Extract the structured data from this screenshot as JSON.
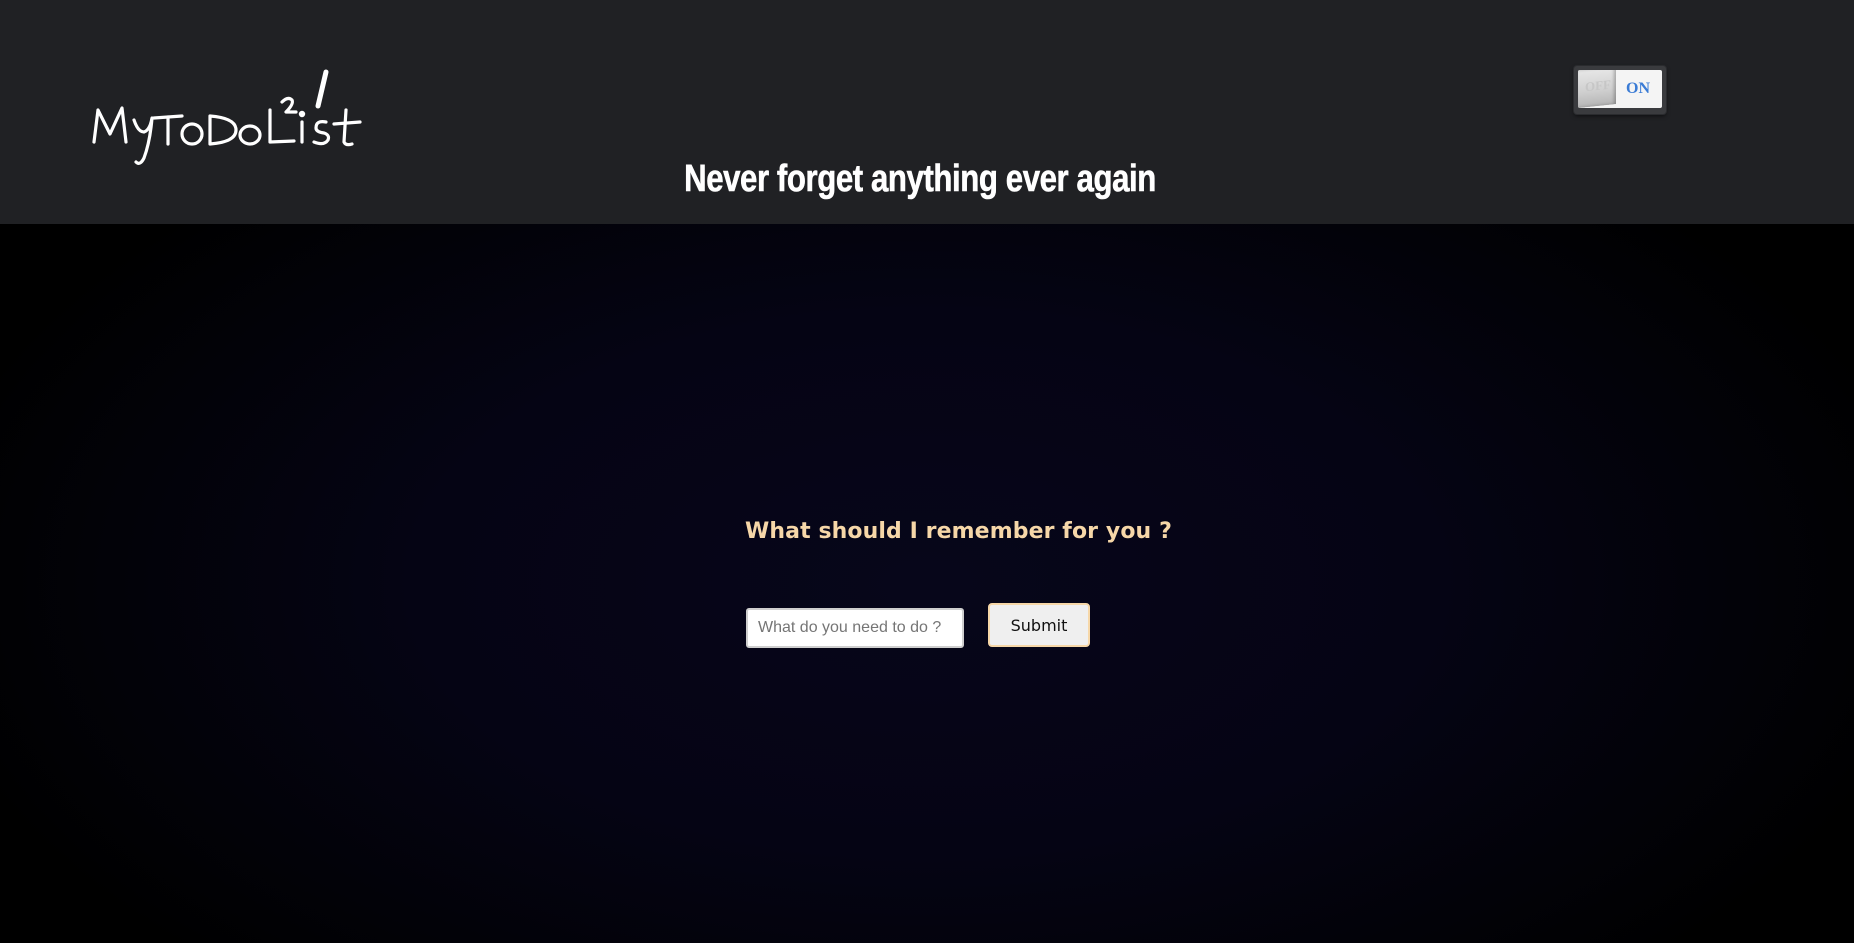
{
  "header": {
    "logo_text": "MyToDoList",
    "tagline": "Never forget anything ever again",
    "theme_toggle": {
      "off_label": "OFF",
      "on_label": "ON",
      "state": "on"
    }
  },
  "main": {
    "prompt": "What should I remember for you ?",
    "input": {
      "placeholder": "What do you need to do ?",
      "value": ""
    },
    "submit_label": "Submit"
  },
  "colors": {
    "header_bg": "#202124",
    "main_bg": "#000000",
    "prompt_color": "#f6d7a8",
    "submit_border": "#f6d7a8",
    "toggle_on_color": "#3a7bd5"
  }
}
